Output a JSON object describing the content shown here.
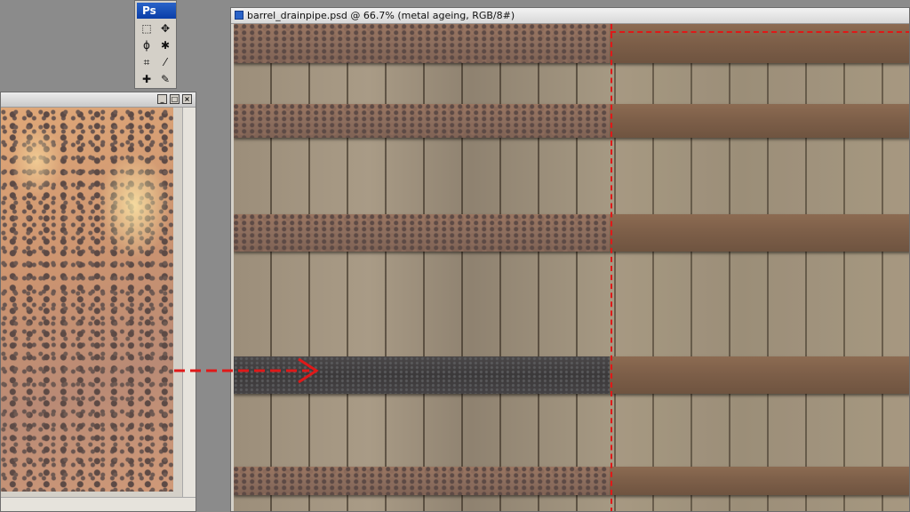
{
  "toolbox": {
    "logo": "Ps",
    "tools": [
      {
        "name": "marquee-tool",
        "glyph": "⬚"
      },
      {
        "name": "move-tool",
        "glyph": "✥"
      },
      {
        "name": "lasso-tool",
        "glyph": "ϕ"
      },
      {
        "name": "magic-wand-tool",
        "glyph": "✱"
      },
      {
        "name": "crop-tool",
        "glyph": "⌗"
      },
      {
        "name": "slice-tool",
        "glyph": "⁄"
      },
      {
        "name": "healing-brush-tool",
        "glyph": "✚"
      },
      {
        "name": "brush-tool",
        "glyph": "✎"
      }
    ]
  },
  "left_window": {
    "buttons": {
      "minimize": "_",
      "maximize": "□",
      "close": "×"
    }
  },
  "main_window": {
    "title": "barrel_drainpipe.psd @ 66.7% (metal ageing, RGB/8#)"
  },
  "colors": {
    "accent_red": "#e01818",
    "workspace": "#8b8b8b"
  }
}
